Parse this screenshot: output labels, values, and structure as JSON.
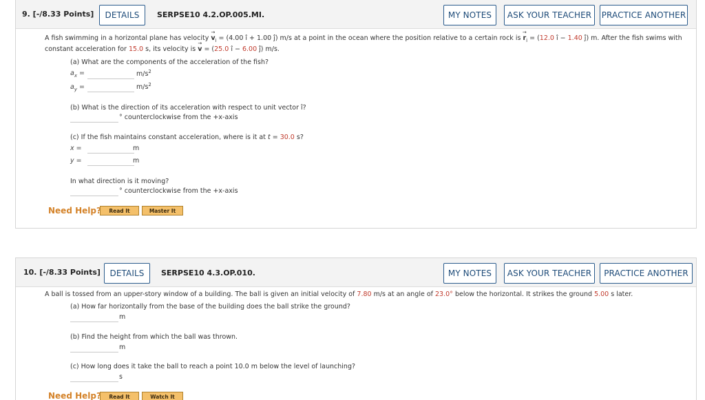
{
  "p9": {
    "number": "9.  [-/8.33 Points]",
    "details": "DETAILS",
    "code": "SERPSE10 4.2.OP.005.MI.",
    "my_notes": "MY NOTES",
    "ask_teacher": "ASK YOUR TEACHER",
    "practice": "PRACTICE ANOTHER",
    "stem_line1_a": "A fish swimming in a horizontal plane has velocity ",
    "stem_vi": "v",
    "stem_sub_i": "i",
    "stem_line1_b": " = (4.00 î + 1.00 ĵ) m/s at a point in the ocean where the position relative to a certain rock is ",
    "stem_ri": "r",
    "stem_sub_i2": "i",
    "stem_line1_c": " = (",
    "rx": "12.0",
    "stem_line1_d": " î − ",
    "ry": "1.40",
    "stem_line1_e": " ĵ) m. After the fish swims with",
    "stem_line2_a": "constant acceleration for ",
    "time": "15.0",
    "stem_line2_b": " s, its velocity is ",
    "stem_v": "v",
    "stem_line2_c": " = (",
    "vx": "25.0",
    "stem_line2_d": " î − ",
    "vy": "6.00",
    "stem_line2_e": " ĵ) m/s.",
    "qa": "(a) What are the components of the acceleration of the fish?",
    "ax_label": "a",
    "ax_sub": "x",
    "ay_label": "a",
    "ay_sub": "y",
    "eq": " =",
    "unit_accel": "m/s",
    "unit_sq": "2",
    "qb": "(b) What is the direction of its acceleration with respect to unit vector î?",
    "deg_ccw": "° counterclockwise from the +x-axis",
    "qc_a": "(c) If the fish maintains constant acceleration, where is it at ",
    "qc_t": "t",
    "qc_b": " = ",
    "qc_time": "30.0",
    "qc_c": " s?",
    "x_label": "x =",
    "y_label": "y =",
    "unit_m": "m",
    "qd": "In what direction is it moving?",
    "need_help": "Need Help?",
    "read_it": "Read It",
    "master_it": "Master It"
  },
  "p10": {
    "number": "10.  [-/8.33 Points]",
    "details": "DETAILS",
    "code": "SERPSE10 4.3.OP.010.",
    "my_notes": "MY NOTES",
    "ask_teacher": "ASK YOUR TEACHER",
    "practice": "PRACTICE ANOTHER",
    "stem_a": "A ball is tossed from an upper-story window of a building. The ball is given an initial velocity of ",
    "v0": "7.80",
    "stem_b": " m/s at an angle of ",
    "angle": "23.0°",
    "stem_c": " below the horizontal. It strikes the ground ",
    "tg": "5.00",
    "stem_d": " s later.",
    "qa": "(a) How far horizontally from the base of the building does the ball strike the ground?",
    "qb": "(b) Find the height from which the ball was thrown.",
    "qc": "(c) How long does it take the ball to reach a point 10.0 m below the level of launching?",
    "unit_m": "m",
    "unit_s": "s",
    "need_help": "Need Help?",
    "read_it": "Read It",
    "watch_it": "Watch It"
  }
}
